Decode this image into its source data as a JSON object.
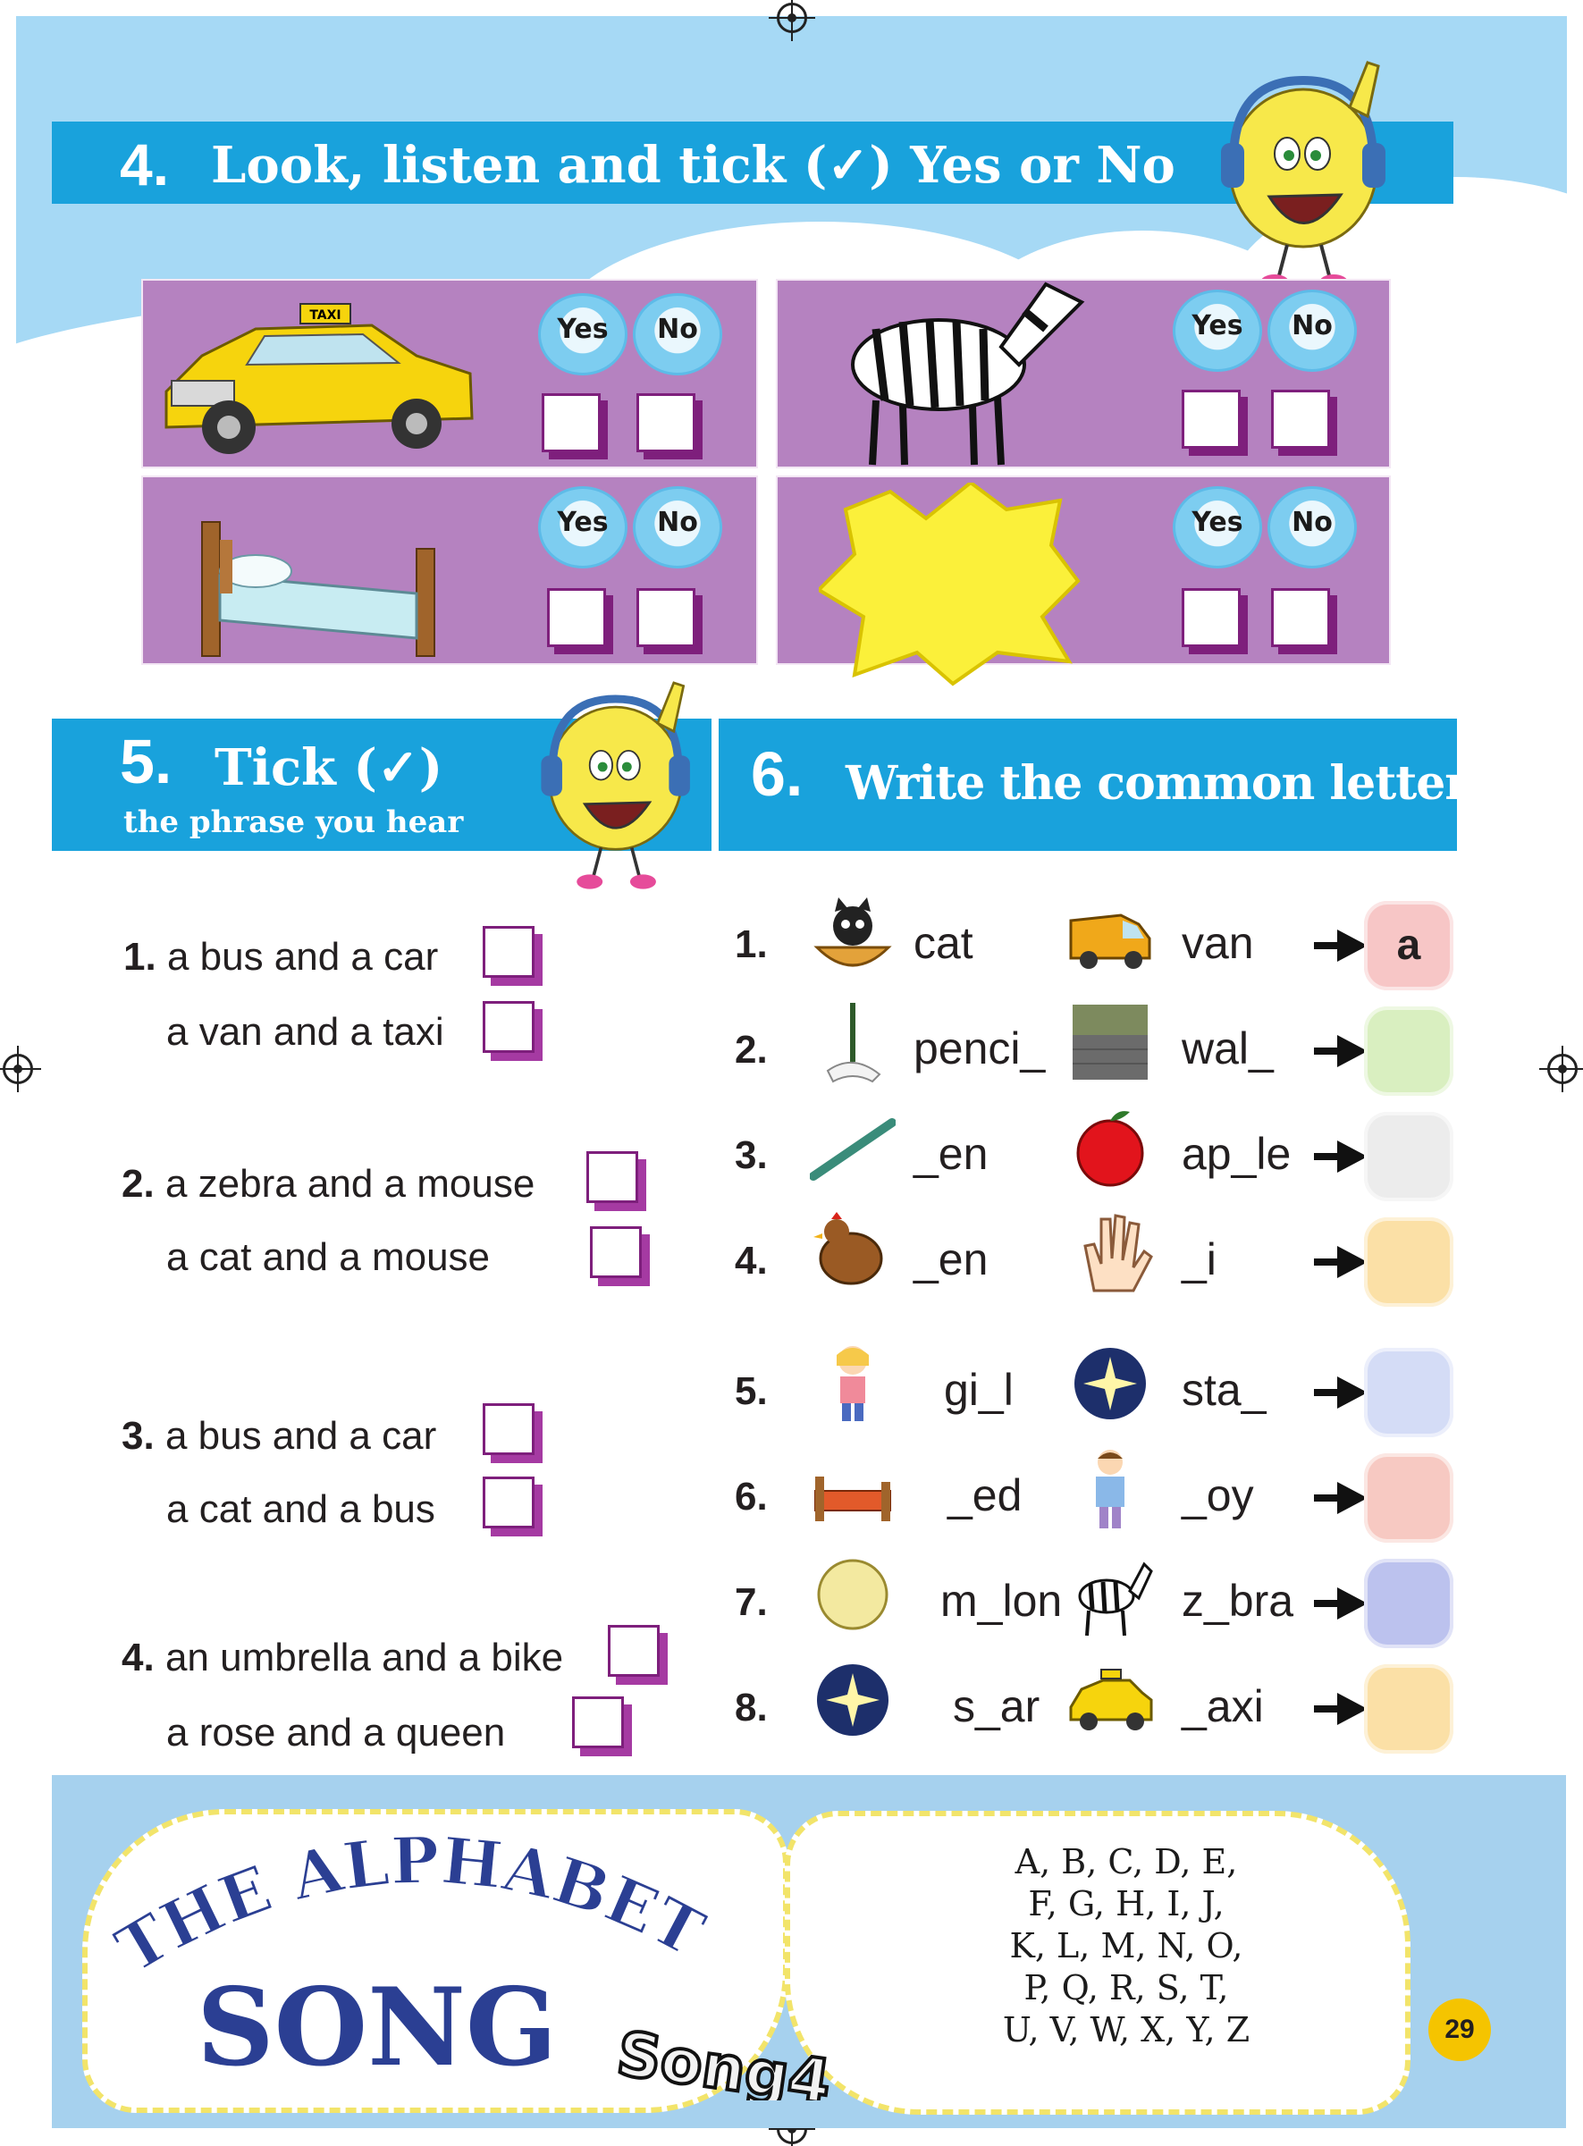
{
  "ex4": {
    "number": "4.",
    "title": "Look, listen and tick (✓) Yes or No",
    "yes_label": "Yes",
    "no_label": "No"
  },
  "ex5": {
    "number": "5.",
    "title": "Tick (✓)",
    "subtitle": "the phrase you hear",
    "items": [
      {
        "num": "1.",
        "a": "a bus and a car",
        "b": "a van and a taxi"
      },
      {
        "num": "2.",
        "a": "a zebra and a mouse",
        "b": "a cat and a mouse"
      },
      {
        "num": "3.",
        "a": "a bus and a car",
        "b": "a cat and a bus"
      },
      {
        "num": "4.",
        "a": "an umbrella and a bike",
        "b": "a rose and a queen"
      }
    ]
  },
  "ex6": {
    "number": "6.",
    "title": "Write the common letter",
    "rows": [
      {
        "num": "1.",
        "w1": "cat",
        "w2": "van",
        "answer": "a",
        "tile": "#f7c6c6"
      },
      {
        "num": "2.",
        "w1": "penci_",
        "w2": "wal_",
        "answer": "",
        "tile": "#d9efc0"
      },
      {
        "num": "3.",
        "w1": "_en",
        "w2": "ap_le",
        "answer": "",
        "tile": "#ececec"
      },
      {
        "num": "4.",
        "w1": "_en",
        "w2": "_i",
        "answer": "",
        "tile": "#fbe0a6"
      },
      {
        "num": "5.",
        "w1": "gi_l",
        "w2": "sta_",
        "answer": "",
        "tile": "#d4dcf6"
      },
      {
        "num": "6.",
        "w1": "_ed",
        "w2": "_oy",
        "answer": "",
        "tile": "#f7c9c2"
      },
      {
        "num": "7.",
        "w1": "m_lon",
        "w2": "z_bra",
        "answer": "",
        "tile": "#bcc2ee"
      },
      {
        "num": "8.",
        "w1": "s_ar",
        "w2": "_axi",
        "answer": "",
        "tile": "#fbe0a6"
      }
    ]
  },
  "song": {
    "title_top": "THE ALPHABET",
    "title_main": "SONG",
    "track": "Song4",
    "lines": [
      "A, B, C, D, E,",
      "F, G, H, I, J,",
      "K, L, M, N, O,",
      "P, Q, R, S, T,",
      "U, V, W, X, Y, Z"
    ]
  },
  "page_number": "29",
  "colors": {
    "header_blue": "#19a2dc",
    "panel_purple": "#b582c0",
    "box_shadow_purple": "#7e1f7c",
    "sky_blue": "#a6d9f5",
    "song_title_blue": "#2b3f93"
  }
}
